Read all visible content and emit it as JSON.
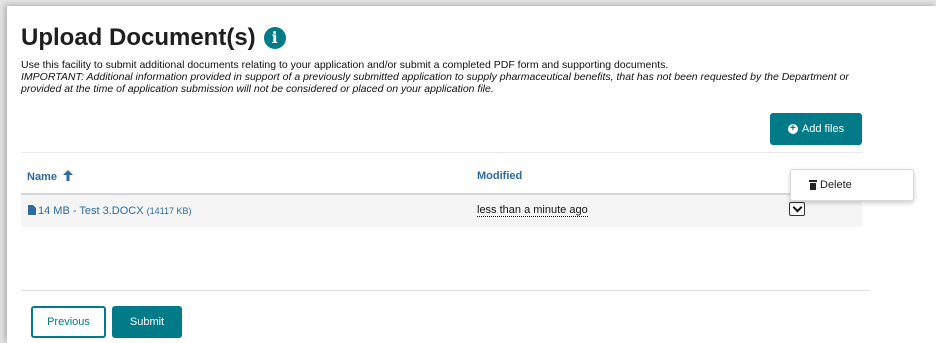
{
  "page": {
    "title": "Upload Document(s)",
    "info_icon": "info-circle-icon",
    "description": "Use this facility to submit additional documents relating to your application and/or submit a completed PDF form and supporting documents.",
    "important": "IMPORTANT: Additional information provided in support of a previously submitted application to supply pharmaceutical benefits, that has not been requested by the Department or provided at the time of application submission will not be considered or placed on your application file."
  },
  "toolbar": {
    "add_files_label": "Add files"
  },
  "table": {
    "columns": [
      {
        "label": "Name",
        "sort": "ascending"
      },
      {
        "label": "Modified"
      }
    ],
    "rows": [
      {
        "name": "14 MB - Test 3.DOCX",
        "size": "(14117 KB)",
        "modified": "less than a minute ago"
      }
    ]
  },
  "row_menu": {
    "items": [
      {
        "label": "Delete",
        "icon": "trash-icon"
      }
    ]
  },
  "footer": {
    "previous_label": "Previous",
    "submit_label": "Submit"
  },
  "colors": {
    "accent": "#007b87",
    "link": "#2c6aa0"
  }
}
